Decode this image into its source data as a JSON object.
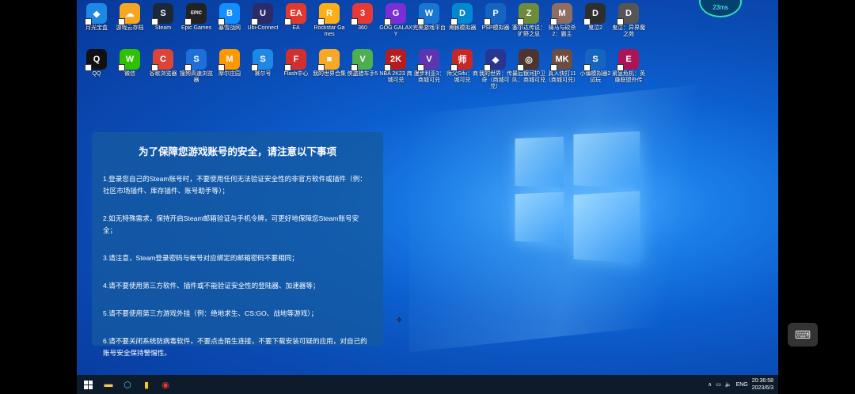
{
  "overlay": {
    "ping": "23ms"
  },
  "desktop_icons": [
    {
      "label": "月光宝盒",
      "color": "#1e88e5",
      "glyph": "◆"
    },
    {
      "label": "游戏云存档",
      "color": "#f5a623",
      "glyph": "☁"
    },
    {
      "label": "Steam",
      "color": "#1b2838",
      "glyph": "S"
    },
    {
      "label": "Epic Games",
      "color": "#222",
      "glyph": "EPIC"
    },
    {
      "label": "暴雪战网",
      "color": "#148eff",
      "glyph": "B"
    },
    {
      "label": "Ubi-Connect",
      "color": "#2b2b6a",
      "glyph": "U"
    },
    {
      "label": "EA",
      "color": "#e03a2f",
      "glyph": "EA"
    },
    {
      "label": "Rockstar Games",
      "color": "#fcaf17",
      "glyph": "R"
    },
    {
      "label": "360",
      "color": "#e53935",
      "glyph": "3"
    },
    {
      "label": "GOG GALAXY",
      "color": "#7a2ed6",
      "glyph": "G"
    },
    {
      "label": "完美游戏平台",
      "color": "#1976d2",
      "glyph": "W"
    },
    {
      "label": "海豚模拟器",
      "color": "#0288d1",
      "glyph": "D"
    },
    {
      "label": "PSP模拟器",
      "color": "#1565c0",
      "glyph": "P"
    },
    {
      "label": "塞尔达传说：旷野之息",
      "color": "#6d8b3a",
      "glyph": "Z"
    },
    {
      "label": "骑马与砍杀2：霸主",
      "color": "#8d6e63",
      "glyph": "M"
    },
    {
      "label": "鬼泣2",
      "color": "#2e2e2e",
      "glyph": "D"
    },
    {
      "label": "鬼泣：异界魔之苑",
      "color": "#555",
      "glyph": "D"
    },
    {
      "label": "QQ",
      "color": "#111",
      "glyph": "Q"
    },
    {
      "label": "微信",
      "color": "#2dc100",
      "glyph": "W"
    },
    {
      "label": "谷歌浏览器",
      "color": "#db4437",
      "glyph": "C"
    },
    {
      "label": "搜狗高速浏览器",
      "color": "#1e6fd9",
      "glyph": "S"
    },
    {
      "label": "摩尔庄园",
      "color": "#ff9800",
      "glyph": "M"
    },
    {
      "label": "赛尔号",
      "color": "#1e88e5",
      "glyph": "S"
    },
    {
      "label": "Flash中心",
      "color": "#d32f2f",
      "glyph": "F"
    },
    {
      "label": "我的世界合集",
      "color": "#f9a825",
      "glyph": "■"
    },
    {
      "label": "侠盗猎车手5",
      "color": "#4caf50",
      "glyph": "V"
    },
    {
      "label": "NBA 2K23 商城可兑",
      "color": "#b71c1c",
      "glyph": "2K"
    },
    {
      "label": "漫步利亚3：商城可兑",
      "color": "#5e35b1",
      "glyph": "V"
    },
    {
      "label": "师父Sifu：商城可兑",
      "color": "#c62828",
      "glyph": "师"
    },
    {
      "label": "我的世界：传奇（商城可兑）",
      "color": "#283593",
      "glyph": "◆"
    },
    {
      "label": "最后银河护卫队：商城可兑",
      "color": "#4e342e",
      "glyph": "◎"
    },
    {
      "label": "真人快打11（商城可兑）",
      "color": "#6d4c41",
      "glyph": "MK"
    },
    {
      "label": "小僵模拟器2试玩",
      "color": "#1565c0",
      "glyph": "S"
    },
    {
      "label": "紧急危机：英雄联盟外传",
      "color": "#ad1457",
      "glyph": "E"
    }
  ],
  "notice": {
    "title": "为了保障您游戏账号的安全，请注意以下事项",
    "items": [
      "1.登录您自己的Steam账号时，不要使用任何无法验证安全性的非官方软件或插件（例：社区市场插件、库存插件、账号助手等）；",
      "2.如无特殊需求，保持开启Steam邮箱验证与手机令牌，可更好地保障您Steam账号安全；",
      "3.请注意，Steam登录密码与帐号对应绑定的邮箱密码不要相同；",
      "4.请不要使用第三方软件、插件或不能验证安全性的登陆器、加速器等；",
      "5.请不要使用第三方游戏外挂（例：绝地求生、CS:GO、战地等游戏）；",
      "6.请不要关闭系统防病毒软件，不要点击陌生连接，不要下载安装可疑的应用，对自己的账号安全保持警惕性。"
    ]
  },
  "taskbar": {
    "apps": [
      {
        "name": "file-explorer-icon",
        "glyph": "▬",
        "color": "#f9c74f"
      },
      {
        "name": "app-cube-icon",
        "glyph": "⬡",
        "color": "#4fc3f7"
      },
      {
        "name": "app-yellow-icon",
        "glyph": "▮",
        "color": "#fbc02d"
      },
      {
        "name": "app-360-icon",
        "glyph": "◉",
        "color": "#e53935"
      }
    ],
    "tray_lang": "ENG",
    "time": "20:36:58",
    "date": "2023/6/3"
  }
}
